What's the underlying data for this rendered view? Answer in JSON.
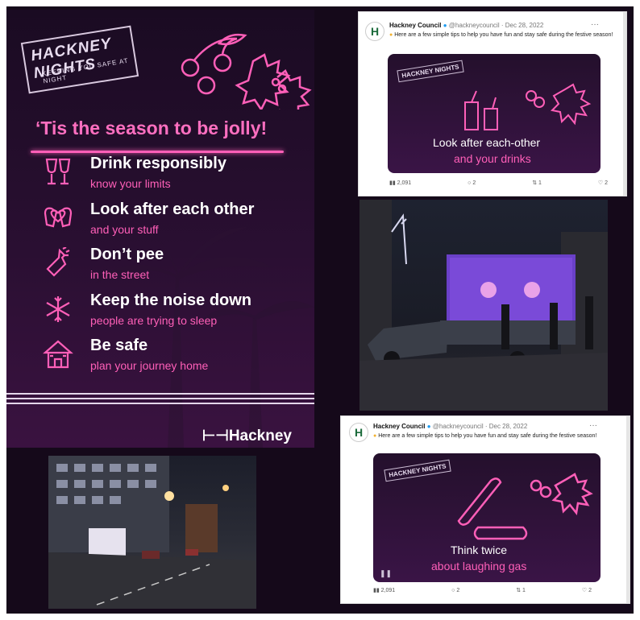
{
  "poster": {
    "logo_title": "HACKNEY NIGHTS",
    "logo_tagline": "KEEPING YOU SAFE AT NIGHT",
    "heading": "‘Tis the season to be jolly!",
    "tips": [
      {
        "title": "Drink responsibly",
        "subtitle": "know your limits",
        "icon": "champagne-glasses-icon"
      },
      {
        "title": "Look after each other",
        "subtitle": "and your stuff",
        "icon": "mittens-heart-icon"
      },
      {
        "title": "Don’t pee",
        "subtitle": "in the street",
        "icon": "bottle-icon"
      },
      {
        "title": "Keep the noise down",
        "subtitle": "people are trying to sleep",
        "icon": "snowflake-icon"
      },
      {
        "title": "Be safe",
        "subtitle": "plan your journey home",
        "icon": "gingerbread-house-icon"
      }
    ],
    "brand": "Hackney"
  },
  "tweet1": {
    "name": "Hackney Council",
    "handle": "@hackneycouncil · Dec 28, 2022",
    "text": "Here are a few simple tips to help you have fun and stay safe during the festive season!",
    "media_title": "Look after each-other",
    "media_subtitle": "and your drinks",
    "stats": {
      "views": "2,091",
      "replies": "2",
      "retweets": "1",
      "likes": "2"
    }
  },
  "tweet2": {
    "name": "Hackney Council",
    "handle": "@hackneycouncil · Dec 28, 2022",
    "text": "Here are a few simple tips to help you have fun and stay safe during the festive season!",
    "media_title": "Think twice",
    "media_subtitle": "about laughing gas",
    "stats": {
      "views": "2,091",
      "replies": "2",
      "retweets": "1",
      "likes": "2"
    }
  },
  "colors": {
    "neon_pink": "#ff5fb8",
    "poster_bg": "#1a0b22",
    "brand_green": "#1a6a3a"
  }
}
